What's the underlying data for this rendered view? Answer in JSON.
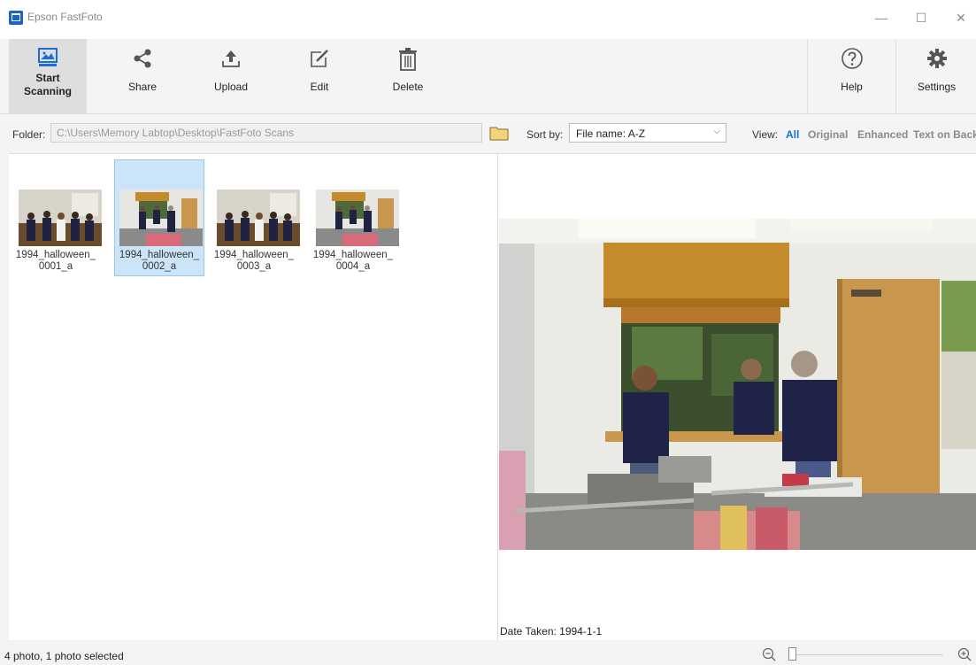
{
  "window": {
    "title": "Epson FastFoto",
    "controls": {
      "minimize": "—",
      "maximize": "☐",
      "close": "✕"
    }
  },
  "toolbar": {
    "start_scanning": "Start Scanning",
    "share": "Share",
    "upload": "Upload",
    "edit": "Edit",
    "delete": "Delete",
    "help": "Help",
    "settings": "Settings"
  },
  "folder": {
    "label": "Folder:",
    "path": "C:\\Users\\Memory Labtop\\Desktop\\FastFoto Scans"
  },
  "sort": {
    "label": "Sort by:",
    "value": "File name: A-Z"
  },
  "view": {
    "label": "View:",
    "options": [
      "All",
      "Original",
      "Enhanced",
      "Text on Back"
    ],
    "selected": "All"
  },
  "thumbnails": [
    {
      "line1": "1994_halloween_",
      "line2": "0001_a",
      "selected": false
    },
    {
      "line1": "1994_halloween_",
      "line2": "0002_a",
      "selected": true
    },
    {
      "line1": "1994_halloween_",
      "line2": "0003_a",
      "selected": false
    },
    {
      "line1": "1994_halloween_",
      "line2": "0004_a",
      "selected": false
    }
  ],
  "preview": {
    "date_taken": "Date Taken: 1994-1-1"
  },
  "status": {
    "text": "4 photo, 1 photo selected"
  },
  "colors": {
    "accent": "#1a6fd4",
    "selection": "#cce4f7",
    "toolbar_bg": "#f4f4f4"
  },
  "icons": [
    "scanner-icon",
    "share-icon",
    "upload-icon",
    "edit-icon",
    "delete-icon",
    "help-icon",
    "settings-icon",
    "folder-icon",
    "zoom-out-icon",
    "zoom-in-icon"
  ]
}
